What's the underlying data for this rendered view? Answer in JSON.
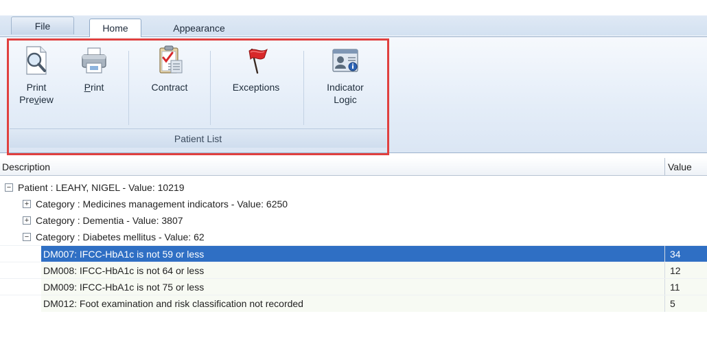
{
  "ribbon": {
    "tabs": [
      {
        "label": "File"
      },
      {
        "label": "Home"
      },
      {
        "label": "Appearance"
      }
    ],
    "buttons": {
      "print_preview": {
        "line1": "Print",
        "line2_pre": "Pre",
        "line2_u": "v",
        "line2_post": "iew",
        "icon": "magnifier-page-icon"
      },
      "print": {
        "label_u": "P",
        "label_rest": "rint",
        "icon": "printer-icon"
      },
      "contract": {
        "label": "Contract",
        "icon": "clipboard-checklist-icon"
      },
      "exceptions": {
        "label": "Exceptions",
        "icon": "red-flag-icon"
      },
      "indicator_logic": {
        "line1": "Indicator",
        "line2": "Logic",
        "icon": "user-info-card-icon"
      }
    },
    "group_label": "Patient List",
    "highlight_color": "#e0403f"
  },
  "list": {
    "columns": {
      "description": "Description",
      "value": "Value"
    },
    "rows": [
      {
        "text": "Patient : LEAHY, NIGEL - Value: 10219",
        "value": "",
        "expander": "−"
      },
      {
        "text": "Category : Medicines management indicators - Value: 6250",
        "value": "",
        "expander": "+"
      },
      {
        "text": "Category : Dementia - Value: 3807",
        "value": "",
        "expander": "+"
      },
      {
        "text": "Category : Diabetes mellitus - Value: 62",
        "value": "",
        "expander": "−"
      },
      {
        "text": "DM007: IFCC-HbA1c is not 59 or less",
        "value": "34"
      },
      {
        "text": "DM008: IFCC-HbA1c is not 64 or less",
        "value": "12"
      },
      {
        "text": "DM009: IFCC-HbA1c is not 75 or less",
        "value": "11"
      },
      {
        "text": "DM012: Foot examination and risk classification not recorded",
        "value": "5"
      }
    ],
    "selected_color": "#2f6fc4"
  }
}
